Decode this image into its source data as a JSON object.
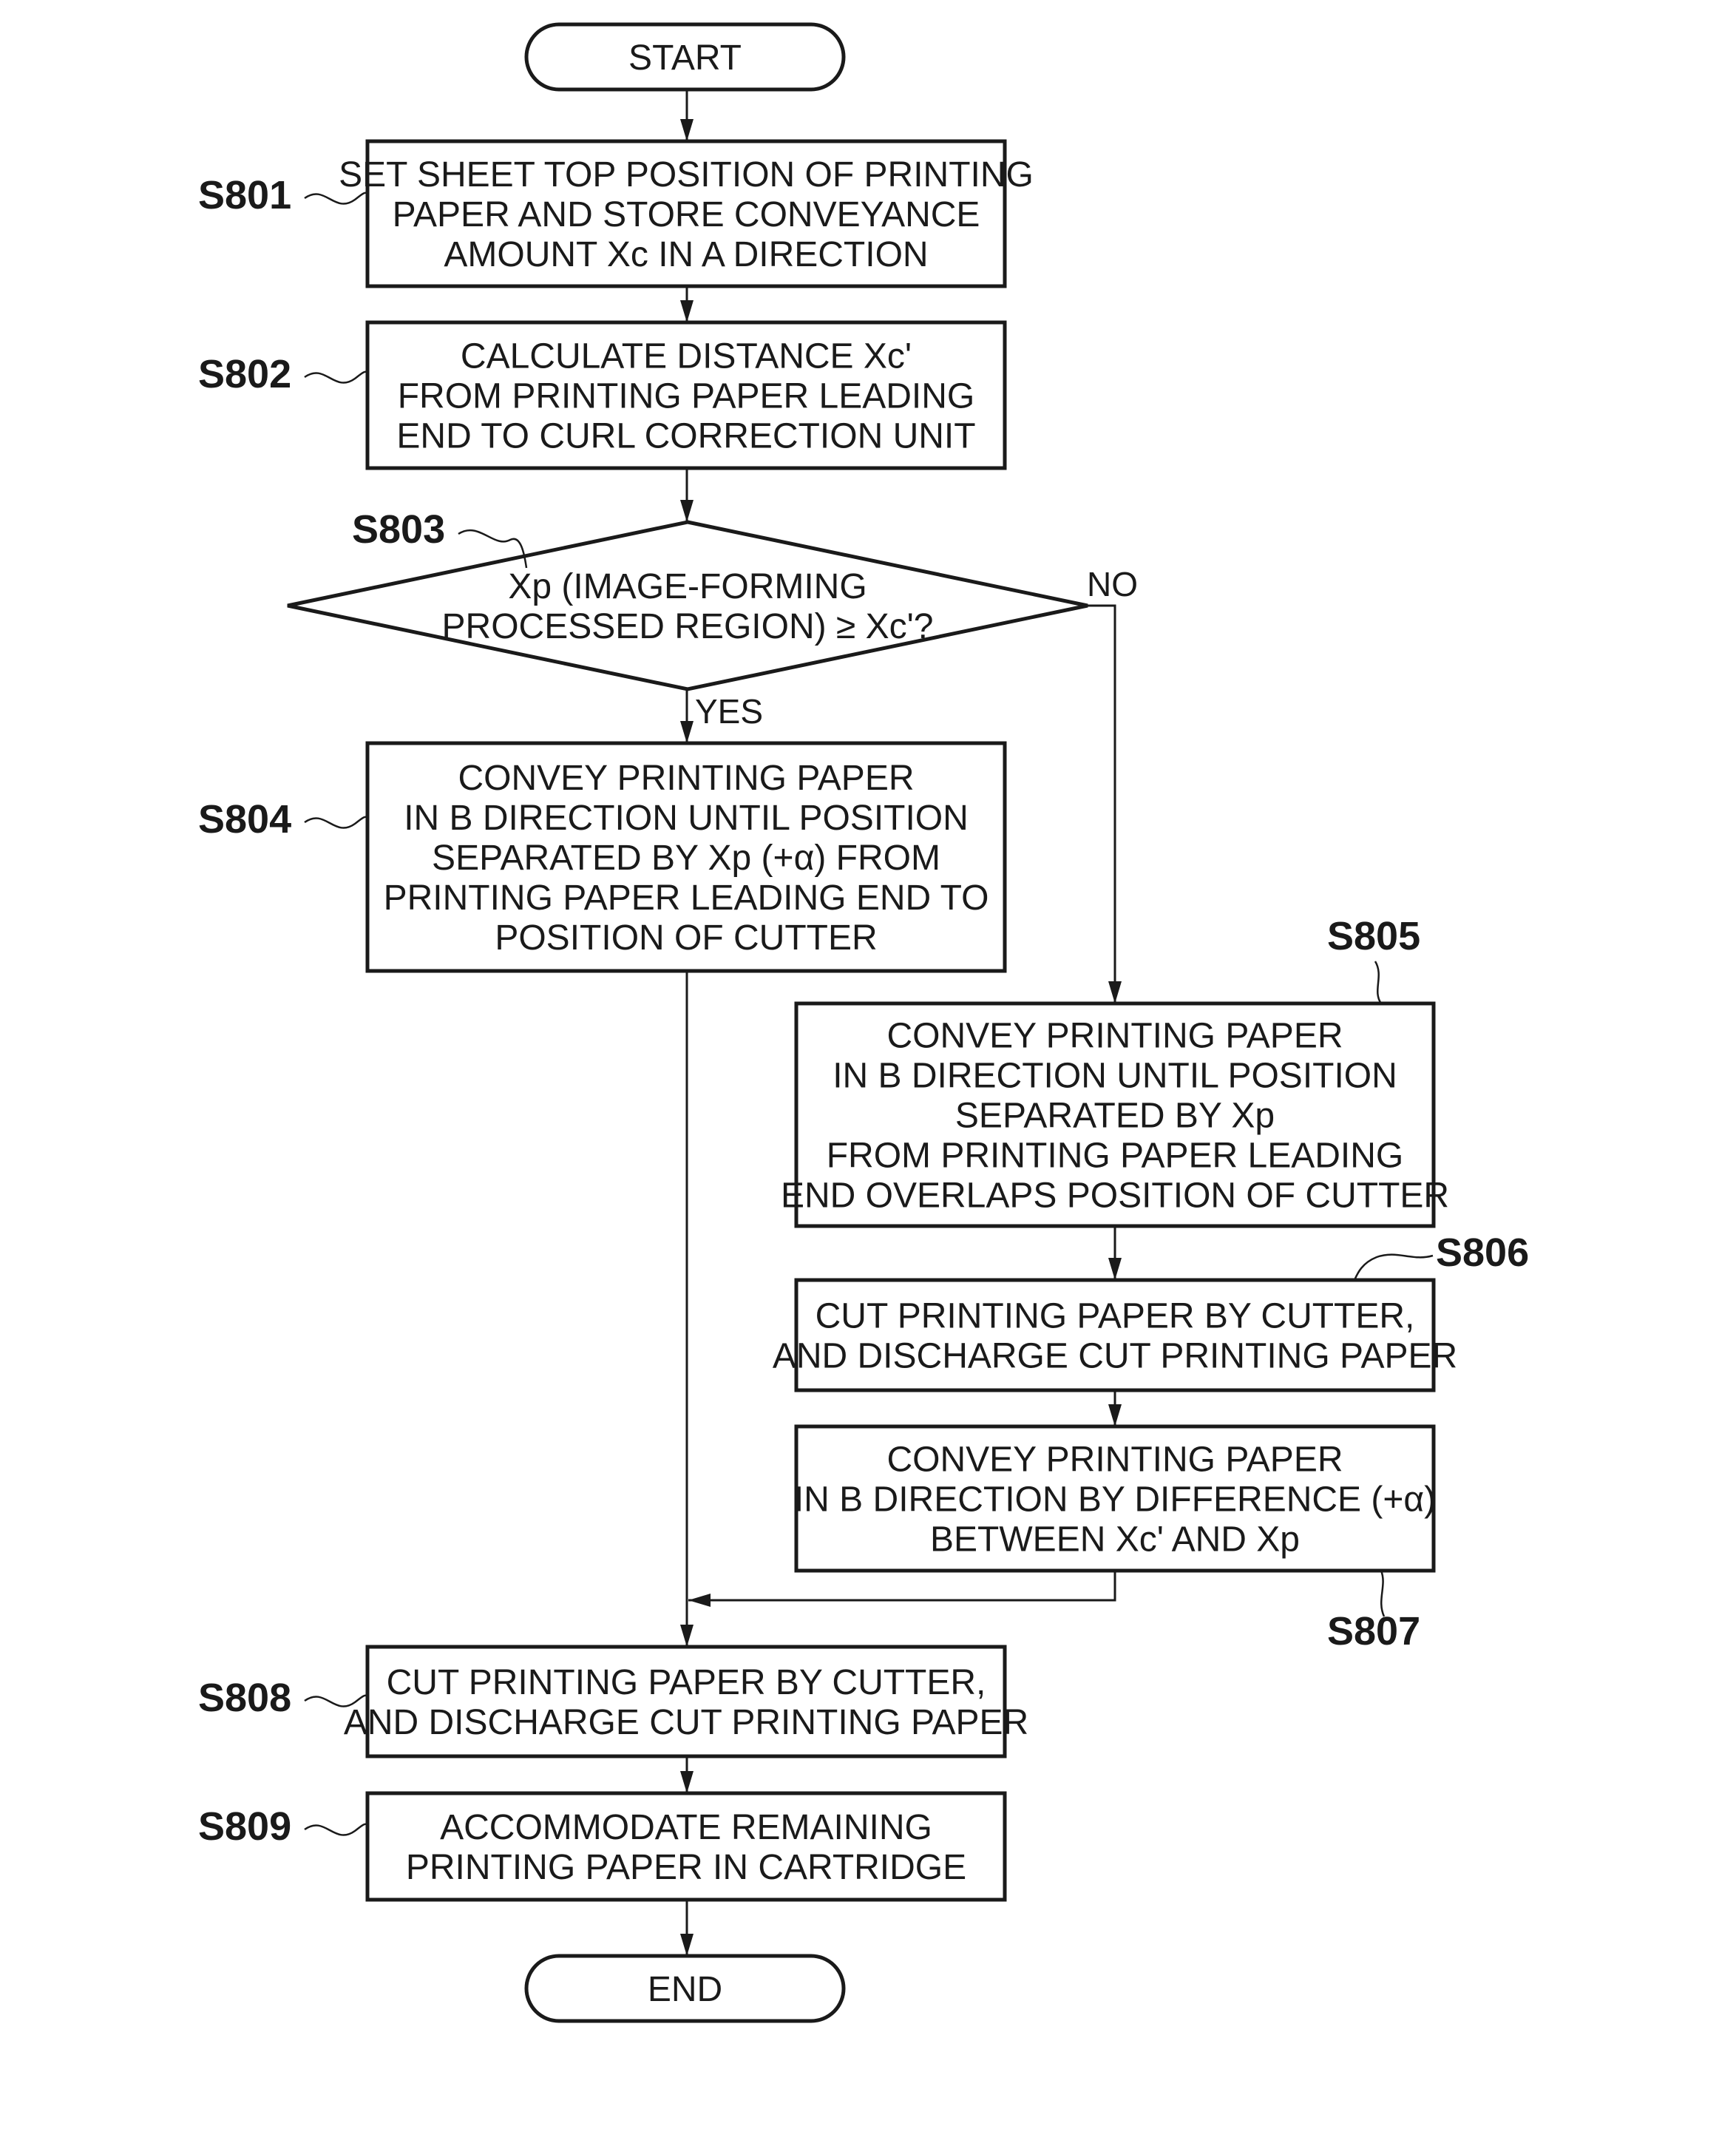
{
  "diagram": {
    "type": "flowchart",
    "nodes": {
      "start": {
        "kind": "terminal",
        "lines": [
          "START"
        ]
      },
      "s801": {
        "kind": "process",
        "step": "S801",
        "lines": [
          "SET SHEET TOP POSITION OF PRINTING",
          "PAPER AND STORE CONVEYANCE",
          "AMOUNT Xc IN A DIRECTION"
        ]
      },
      "s802": {
        "kind": "process",
        "step": "S802",
        "lines": [
          "CALCULATE DISTANCE Xc'",
          "FROM PRINTING PAPER LEADING",
          "END TO CURL CORRECTION UNIT"
        ]
      },
      "s803": {
        "kind": "decision",
        "step": "S803",
        "lines": [
          "Xp (IMAGE-FORMING",
          "PROCESSED REGION) ≥ Xc'?"
        ]
      },
      "s804": {
        "kind": "process",
        "step": "S804",
        "lines": [
          "CONVEY PRINTING PAPER",
          "IN B DIRECTION UNTIL POSITION",
          "SEPARATED BY Xp (+α) FROM",
          "PRINTING PAPER LEADING END TO",
          "POSITION OF CUTTER"
        ]
      },
      "s805": {
        "kind": "process",
        "step": "S805",
        "lines": [
          "CONVEY PRINTING PAPER",
          "IN B DIRECTION UNTIL POSITION",
          "SEPARATED BY Xp",
          "FROM PRINTING PAPER LEADING",
          "END OVERLAPS POSITION OF CUTTER"
        ]
      },
      "s806": {
        "kind": "process",
        "step": "S806",
        "lines": [
          "CUT PRINTING PAPER BY CUTTER,",
          "AND DISCHARGE CUT PRINTING PAPER"
        ]
      },
      "s807": {
        "kind": "process",
        "step": "S807",
        "lines": [
          "CONVEY PRINTING PAPER",
          "IN B DIRECTION BY DIFFERENCE (+α)",
          "BETWEEN Xc' AND Xp"
        ]
      },
      "s808": {
        "kind": "process",
        "step": "S808",
        "lines": [
          "CUT PRINTING PAPER BY CUTTER,",
          "AND DISCHARGE CUT PRINTING PAPER"
        ]
      },
      "s809": {
        "kind": "process",
        "step": "S809",
        "lines": [
          "ACCOMMODATE REMAINING",
          "PRINTING PAPER IN CARTRIDGE"
        ]
      },
      "end": {
        "kind": "terminal",
        "lines": [
          "END"
        ]
      }
    },
    "edges": [
      {
        "from": "start",
        "to": "s801"
      },
      {
        "from": "s801",
        "to": "s802"
      },
      {
        "from": "s802",
        "to": "s803"
      },
      {
        "from": "s803",
        "to": "s804",
        "label": "YES"
      },
      {
        "from": "s803",
        "to": "s805",
        "label": "NO"
      },
      {
        "from": "s804",
        "to": "s808"
      },
      {
        "from": "s805",
        "to": "s806"
      },
      {
        "from": "s806",
        "to": "s807"
      },
      {
        "from": "s807",
        "to": "s808"
      },
      {
        "from": "s808",
        "to": "s809"
      },
      {
        "from": "s809",
        "to": "end"
      }
    ],
    "branch_labels": {
      "yes": "YES",
      "no": "NO"
    },
    "colors": {
      "stroke": "#1a1a1a",
      "background": "#ffffff"
    }
  }
}
